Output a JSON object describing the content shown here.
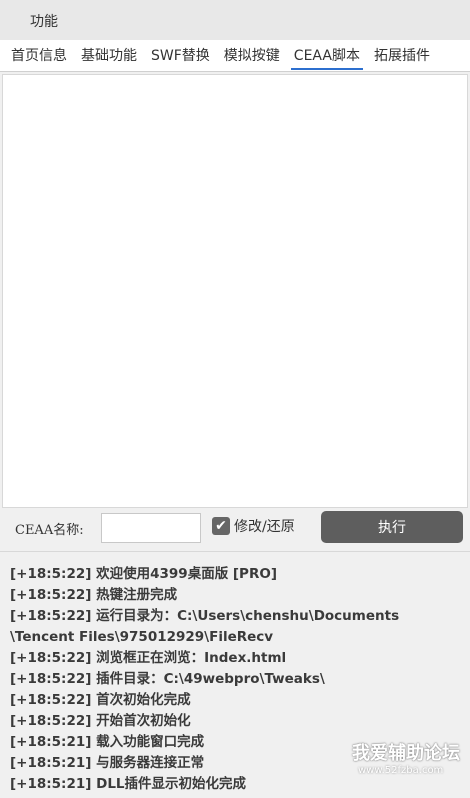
{
  "window": {
    "title": "功能"
  },
  "tabs": [
    {
      "label": "首页信息",
      "active": false
    },
    {
      "label": "基础功能",
      "active": false
    },
    {
      "label": "SWF替换",
      "active": false
    },
    {
      "label": "模拟按键",
      "active": false
    },
    {
      "label": "CEAA脚本",
      "active": true
    },
    {
      "label": "拓展插件",
      "active": false
    }
  ],
  "form": {
    "name_label": "CEAA名称:",
    "name_value": "",
    "checkbox_label": "修改/还原",
    "checkbox_checked": true,
    "checkbox_icon": "check-icon",
    "execute_label": "执行"
  },
  "log": [
    "[+18:5:22] 欢迎使用4399桌面版 [PRO]",
    "[+18:5:22] 热键注册完成",
    "[+18:5:22] 运行目录为：C:\\Users\\chenshu\\Documents",
    "\\Tencent Files\\975012929\\FileRecv",
    "[+18:5:22] 浏览框正在浏览：Index.html",
    "[+18:5:22] 插件目录：C:\\49webpro\\Tweaks\\",
    "[+18:5:22] 首次初始化完成",
    "[+18:5:22] 开始首次初始化",
    "[+18:5:21] 载入功能窗口完成",
    "[+18:5:21] 与服务器连接正常",
    "[+18:5:21] DLL插件显示初始化完成"
  ],
  "watermark": {
    "text": "我爱辅助论坛",
    "url": "www.52fzba.com"
  },
  "colors": {
    "active_tab_underline": "#2c6fcf",
    "button_bg": "#5e5e5e",
    "checkbox_bg": "#666666"
  }
}
